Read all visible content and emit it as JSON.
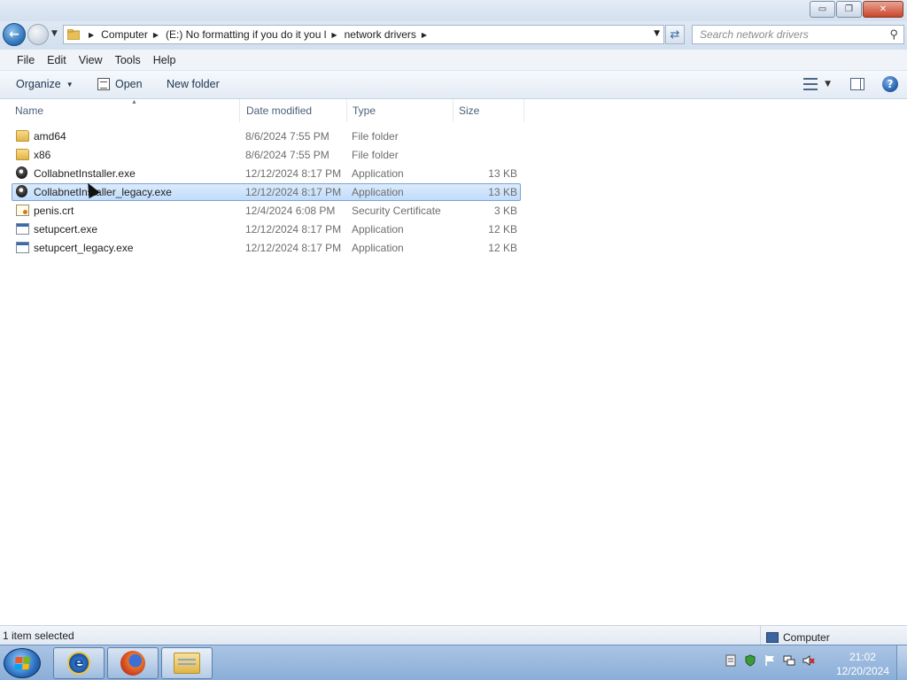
{
  "window": {
    "minimize_glyph": "▭",
    "maximize_glyph": "❐",
    "close_glyph": "✕"
  },
  "nav": {
    "breadcrumbs": [
      "Computer",
      "(E:) No formatting if you do it you l",
      "network drivers"
    ],
    "search_placeholder": "Search network drivers"
  },
  "menu": {
    "items": [
      "File",
      "Edit",
      "View",
      "Tools",
      "Help"
    ]
  },
  "commands": {
    "organize": "Organize",
    "open": "Open",
    "new_folder": "New folder"
  },
  "columns": {
    "name": "Name",
    "date": "Date modified",
    "type": "Type",
    "size": "Size"
  },
  "files": [
    {
      "name": "amd64",
      "date": "8/6/2024 7:55 PM",
      "type": "File folder",
      "size": "",
      "icon": "folder-icon"
    },
    {
      "name": "x86",
      "date": "8/6/2024 7:55 PM",
      "type": "File folder",
      "size": "",
      "icon": "folder-icon"
    },
    {
      "name": "CollabnetInstaller.exe",
      "date": "12/12/2024 8:17 PM",
      "type": "Application",
      "size": "13 KB",
      "icon": "installer-icon"
    },
    {
      "name": "CollabnetInstaller_legacy.exe",
      "date": "12/12/2024 8:17 PM",
      "type": "Application",
      "size": "13 KB",
      "icon": "installer-icon",
      "selected": true
    },
    {
      "name": "penis.crt",
      "date": "12/4/2024 6:08 PM",
      "type": "Security Certificate",
      "size": "3 KB",
      "icon": "certificate-icon"
    },
    {
      "name": "setupcert.exe",
      "date": "12/12/2024 8:17 PM",
      "type": "Application",
      "size": "12 KB",
      "icon": "application-icon"
    },
    {
      "name": "setupcert_legacy.exe",
      "date": "12/12/2024 8:17 PM",
      "type": "Application",
      "size": "12 KB",
      "icon": "application-icon"
    }
  ],
  "status": {
    "selection": "1 item selected",
    "location": "Computer"
  },
  "clock": {
    "time": "21:02",
    "date": "12/20/2024"
  },
  "colors": {
    "selection_fill": "#cde3fc",
    "selection_border": "#7da2ce",
    "taskbar": "#9bb9de"
  }
}
